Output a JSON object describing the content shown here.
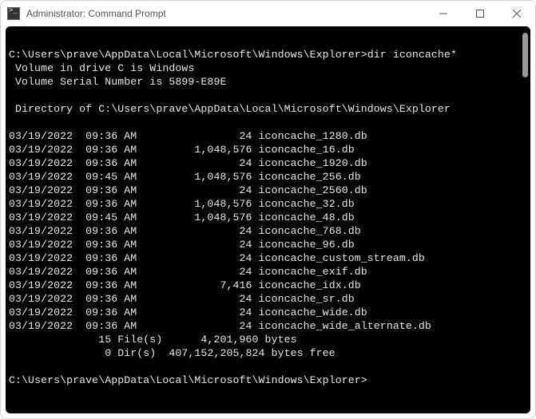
{
  "window": {
    "title": "Administrator: Command Prompt"
  },
  "terminal": {
    "prompt_path": "C:\\Users\\prave\\AppData\\Local\\Microsoft\\Windows\\Explorer>",
    "command": "dir iconcache*",
    "volume_line": " Volume in drive C is Windows",
    "serial_line": " Volume Serial Number is 5899-E89E",
    "dir_of_line": " Directory of C:\\Users\\prave\\AppData\\Local\\Microsoft\\Windows\\Explorer",
    "entries": [
      {
        "date": "03/19/2022",
        "time": "09:36 AM",
        "size": "24",
        "name": "iconcache_1280.db"
      },
      {
        "date": "03/19/2022",
        "time": "09:36 AM",
        "size": "1,048,576",
        "name": "iconcache_16.db"
      },
      {
        "date": "03/19/2022",
        "time": "09:36 AM",
        "size": "24",
        "name": "iconcache_1920.db"
      },
      {
        "date": "03/19/2022",
        "time": "09:45 AM",
        "size": "1,048,576",
        "name": "iconcache_256.db"
      },
      {
        "date": "03/19/2022",
        "time": "09:36 AM",
        "size": "24",
        "name": "iconcache_2560.db"
      },
      {
        "date": "03/19/2022",
        "time": "09:36 AM",
        "size": "1,048,576",
        "name": "iconcache_32.db"
      },
      {
        "date": "03/19/2022",
        "time": "09:45 AM",
        "size": "1,048,576",
        "name": "iconcache_48.db"
      },
      {
        "date": "03/19/2022",
        "time": "09:36 AM",
        "size": "24",
        "name": "iconcache_768.db"
      },
      {
        "date": "03/19/2022",
        "time": "09:36 AM",
        "size": "24",
        "name": "iconcache_96.db"
      },
      {
        "date": "03/19/2022",
        "time": "09:36 AM",
        "size": "24",
        "name": "iconcache_custom_stream.db"
      },
      {
        "date": "03/19/2022",
        "time": "09:36 AM",
        "size": "24",
        "name": "iconcache_exif.db"
      },
      {
        "date": "03/19/2022",
        "time": "09:36 AM",
        "size": "7,416",
        "name": "iconcache_idx.db"
      },
      {
        "date": "03/19/2022",
        "time": "09:36 AM",
        "size": "24",
        "name": "iconcache_sr.db"
      },
      {
        "date": "03/19/2022",
        "time": "09:36 AM",
        "size": "24",
        "name": "iconcache_wide.db"
      },
      {
        "date": "03/19/2022",
        "time": "09:36 AM",
        "size": "24",
        "name": "iconcache_wide_alternate.db"
      }
    ],
    "summary_files": {
      "count": "15",
      "label": "File(s)",
      "bytes": "4,201,960 bytes"
    },
    "summary_dirs": {
      "count": "0",
      "label": "Dir(s)",
      "bytes": "407,152,205,824 bytes free"
    },
    "final_prompt": "C:\\Users\\prave\\AppData\\Local\\Microsoft\\Windows\\Explorer>"
  }
}
